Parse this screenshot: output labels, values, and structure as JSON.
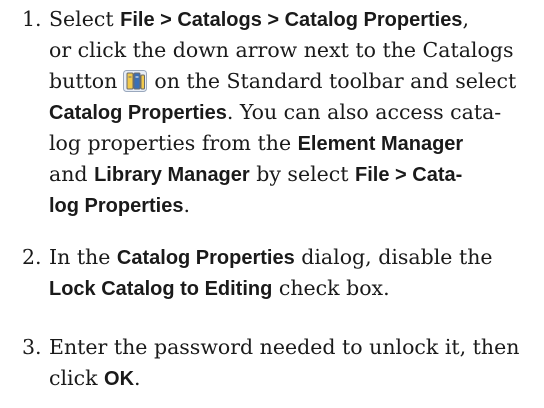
{
  "steps": [
    {
      "number": "1.",
      "l1": {
        "a": "Select ",
        "b": "File > Catalogs > Catalog Properties",
        "c": ","
      },
      "l2": {
        "a": "or click the down arrow next to the Catalogs"
      },
      "l3": {
        "a": "button",
        "c": "on the Standard toolbar and select"
      },
      "l4": {
        "b": "Catalog Properties",
        "c": ". You can also access cata-"
      },
      "l5": {
        "a": "log properties from the ",
        "b": "Element Manager"
      },
      "l6": {
        "a": "and ",
        "b": "Library Manager",
        "c": " by select ",
        "d": "File > Cata-"
      },
      "l7": {
        "b": "log Properties",
        "c": "."
      }
    },
    {
      "number": "2.",
      "l1": {
        "a": "In the ",
        "b": "Catalog Properties",
        "c": " dialog, disable the"
      },
      "l2": {
        "b": "Lock Catalog to Editing",
        "c": " check box."
      }
    },
    {
      "number": "3.",
      "l1": {
        "a": "Enter the password needed to unlock it, then"
      },
      "l2": {
        "a": "click ",
        "b": "OK",
        "c": "."
      }
    }
  ],
  "icons": {
    "catalogs_button": "catalogs-book-icon",
    "colors": {
      "book_yellow": "#f2c94c",
      "book_blue": "#3b6fb6",
      "book_outline": "#6b6b6b"
    }
  }
}
